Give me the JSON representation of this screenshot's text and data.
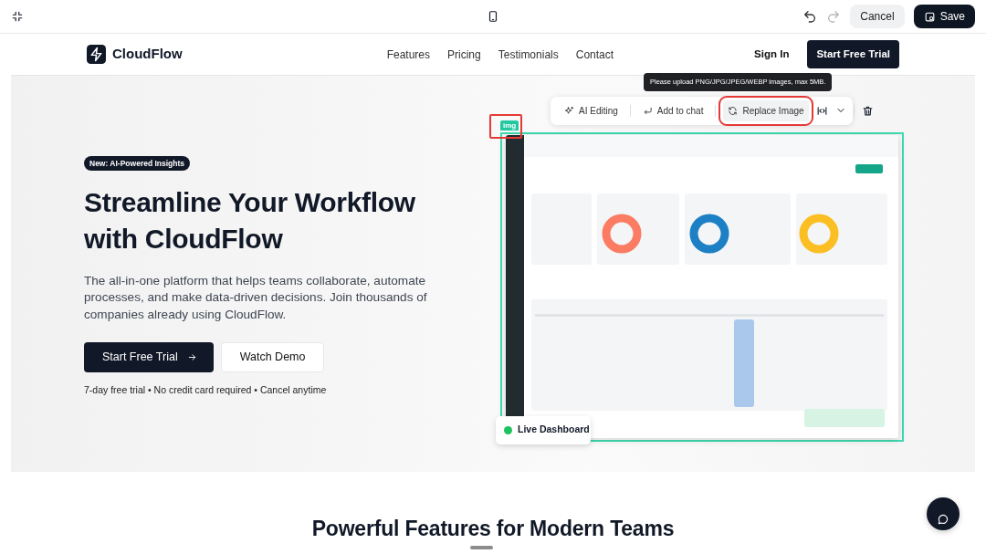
{
  "editor_bar": {
    "history": [
      {
        "kind": "undo",
        "disabled": false
      },
      {
        "kind": "redo",
        "disabled": true
      }
    ],
    "buttons": [
      {
        "label": "Cancel",
        "kind": "secondary"
      },
      {
        "label": "Save",
        "kind": "primary"
      }
    ]
  },
  "nav": {
    "brand": "CloudFlow",
    "links": [
      "Features",
      "Pricing",
      "Testimonials",
      "Contact"
    ],
    "sign_in": "Sign In",
    "cta": "Start Free Trial"
  },
  "hero": {
    "badge": "New: AI-Powered Insights",
    "title_lines": [
      "Streamline Your Workflow",
      "with CloudFlow"
    ],
    "text": "The all-in-one platform that helps teams collaborate, automate processes, and make data-driven decisions. Join thousands of companies already using CloudFlow.",
    "primary_button": "Start Free Trial",
    "secondary_button": "Watch Demo",
    "note": "7-day free trial • No credit card required • Cancel anytime"
  },
  "image_toolbar": {
    "tooltip": "Please upload PNG/JPG/JPEG/WEBP images, max 5MB.",
    "tag": "img",
    "items": [
      {
        "label": "AI Editing",
        "kind": "ai",
        "highlighted": false
      },
      {
        "label": "Add to chat",
        "kind": "chat",
        "highlighted": false
      },
      {
        "label": "Replace Image",
        "kind": "replace",
        "highlighted": true
      }
    ]
  },
  "dashboard": {
    "live_badge": "Live Dashboard"
  },
  "features": {
    "title": "Powerful Features for Modern Teams"
  }
}
